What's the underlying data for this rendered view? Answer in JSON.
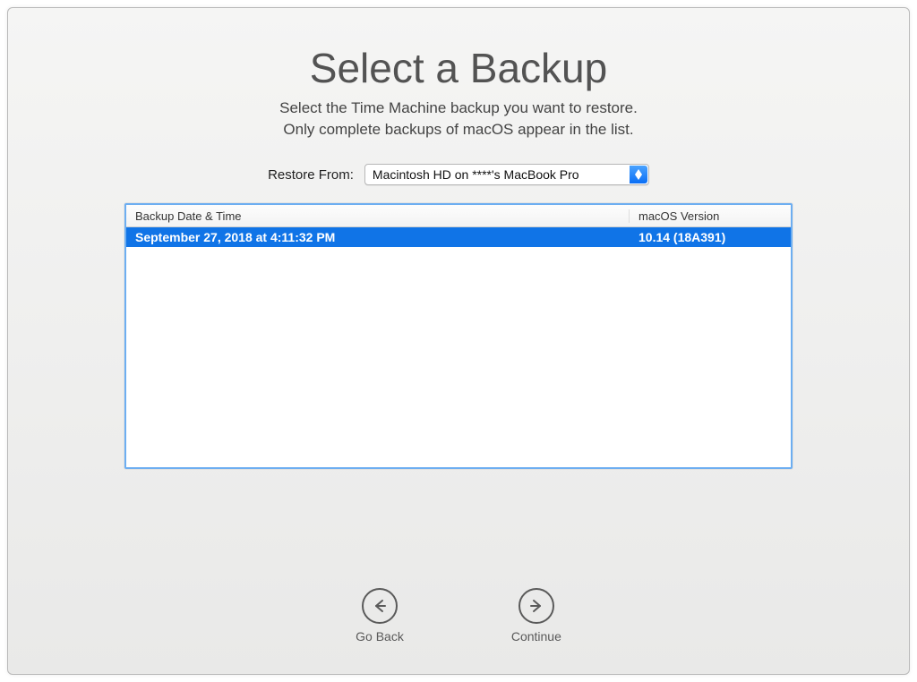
{
  "header": {
    "title": "Select a Backup",
    "subtitle_line1": "Select the Time Machine backup you want to restore.",
    "subtitle_line2": "Only complete backups of macOS appear in the list."
  },
  "restore": {
    "label": "Restore From:",
    "selected": "Macintosh HD on ****'s MacBook Pro"
  },
  "table": {
    "col_date": "Backup Date & Time",
    "col_version": "macOS Version",
    "rows": [
      {
        "date": "September 27, 2018 at 4:11:32 PM",
        "version": "10.14 (18A391)"
      }
    ]
  },
  "nav": {
    "back": "Go Back",
    "continue": "Continue"
  }
}
